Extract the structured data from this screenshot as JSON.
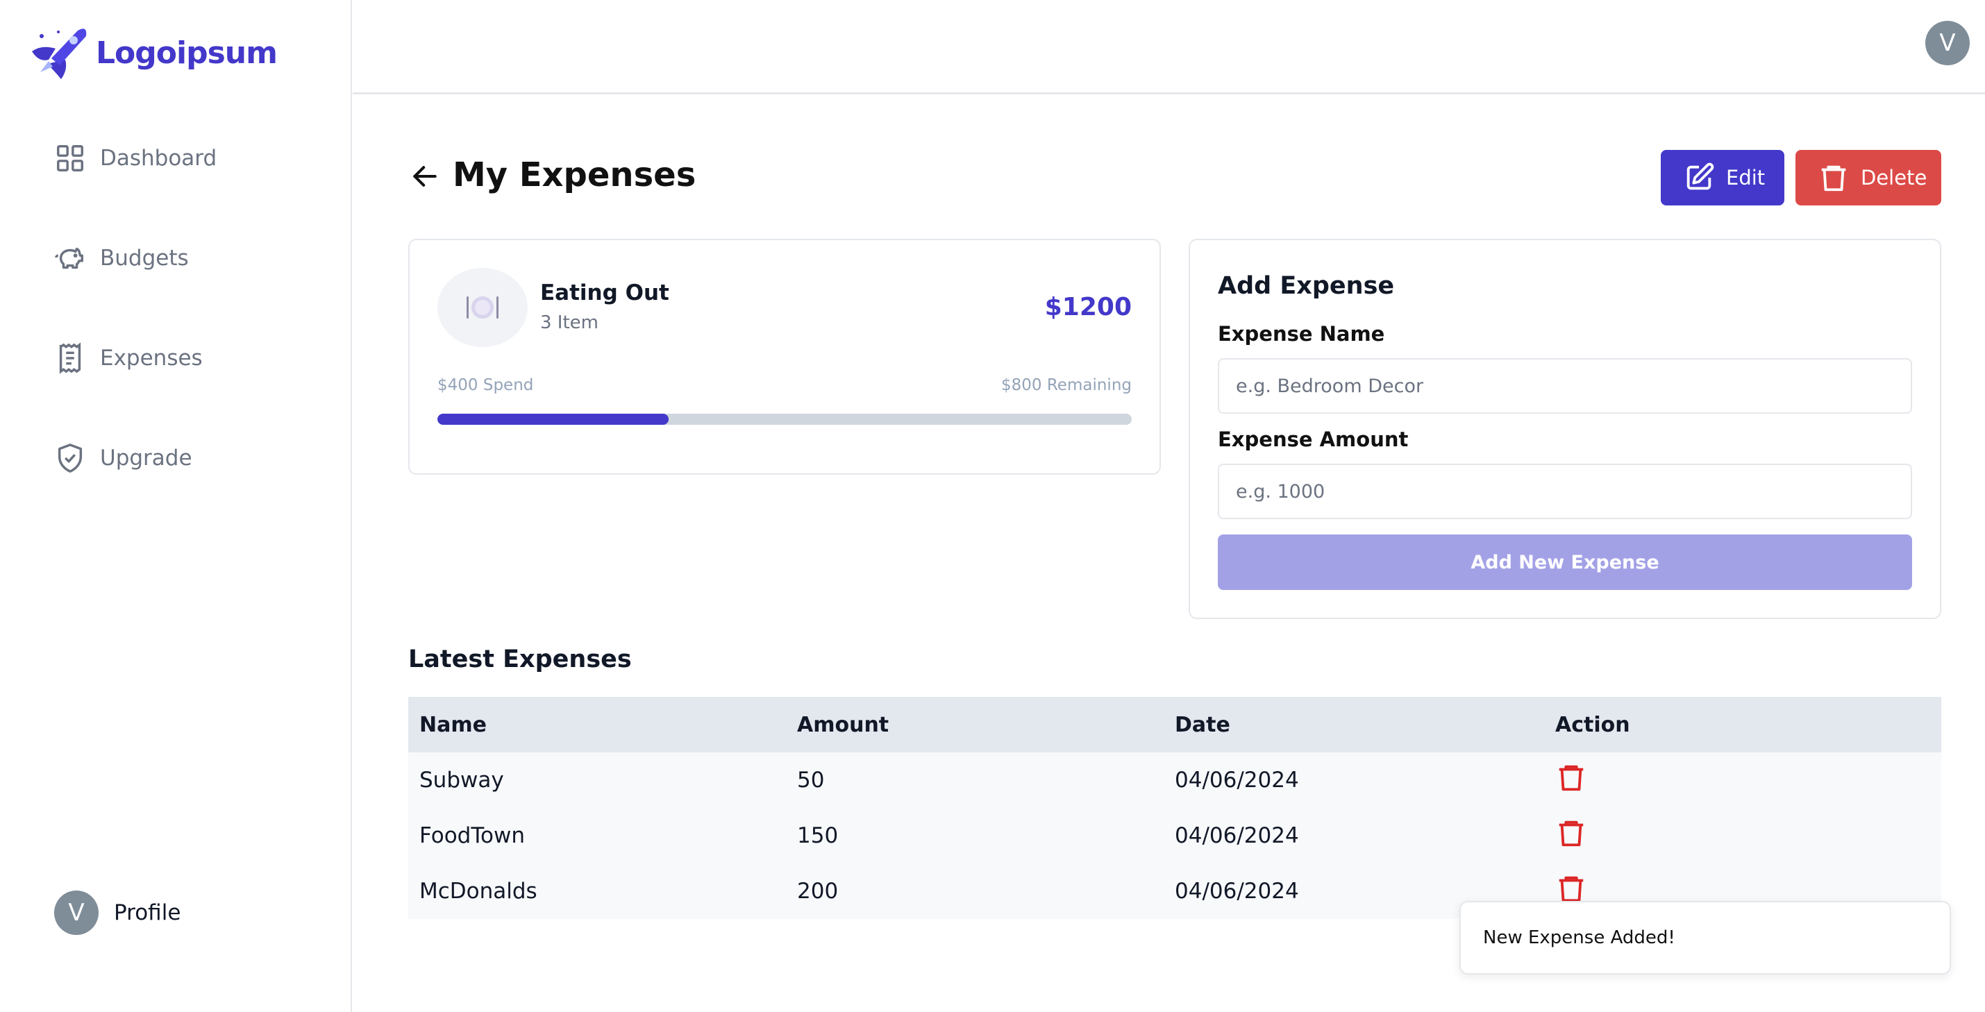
{
  "brand": {
    "name": "Logoipsum",
    "accent_color": "#4338ca"
  },
  "sidebar": {
    "items": [
      {
        "label": "Dashboard",
        "icon": "grid-icon"
      },
      {
        "label": "Budgets",
        "icon": "piggy-bank-icon"
      },
      {
        "label": "Expenses",
        "icon": "receipt-icon"
      },
      {
        "label": "Upgrade",
        "icon": "shield-check-icon"
      }
    ],
    "profile": {
      "initial": "V",
      "label": "Profile"
    }
  },
  "topbar": {
    "avatar_initial": "V"
  },
  "header": {
    "title": "My Expenses",
    "edit_label": "Edit",
    "delete_label": "Delete"
  },
  "budget": {
    "name": "Eating Out",
    "items": "3 Item",
    "amount": "$1200",
    "spend": "$400 Spend",
    "remaining": "$800 Remaining",
    "progress_fraction": 0.333,
    "emoji": "🍽️"
  },
  "add_expense": {
    "title": "Add Expense",
    "name_label": "Expense Name",
    "name_placeholder": "e.g. Bedroom Decor",
    "amount_label": "Expense Amount",
    "amount_placeholder": "e.g. 1000",
    "button_label": "Add New Expense"
  },
  "latest": {
    "title": "Latest Expenses",
    "columns": [
      "Name",
      "Amount",
      "Date",
      "Action"
    ],
    "rows": [
      {
        "name": "Subway",
        "amount": "50",
        "date": "04/06/2024"
      },
      {
        "name": "FoodTown",
        "amount": "150",
        "date": "04/06/2024"
      },
      {
        "name": "McDonalds",
        "amount": "200",
        "date": "04/06/2024"
      }
    ]
  },
  "toast": {
    "message": "New Expense Added!"
  },
  "colors": {
    "danger": "#dc4a47",
    "primary": "#4338ca",
    "primary_light": "#a3a1e6"
  }
}
